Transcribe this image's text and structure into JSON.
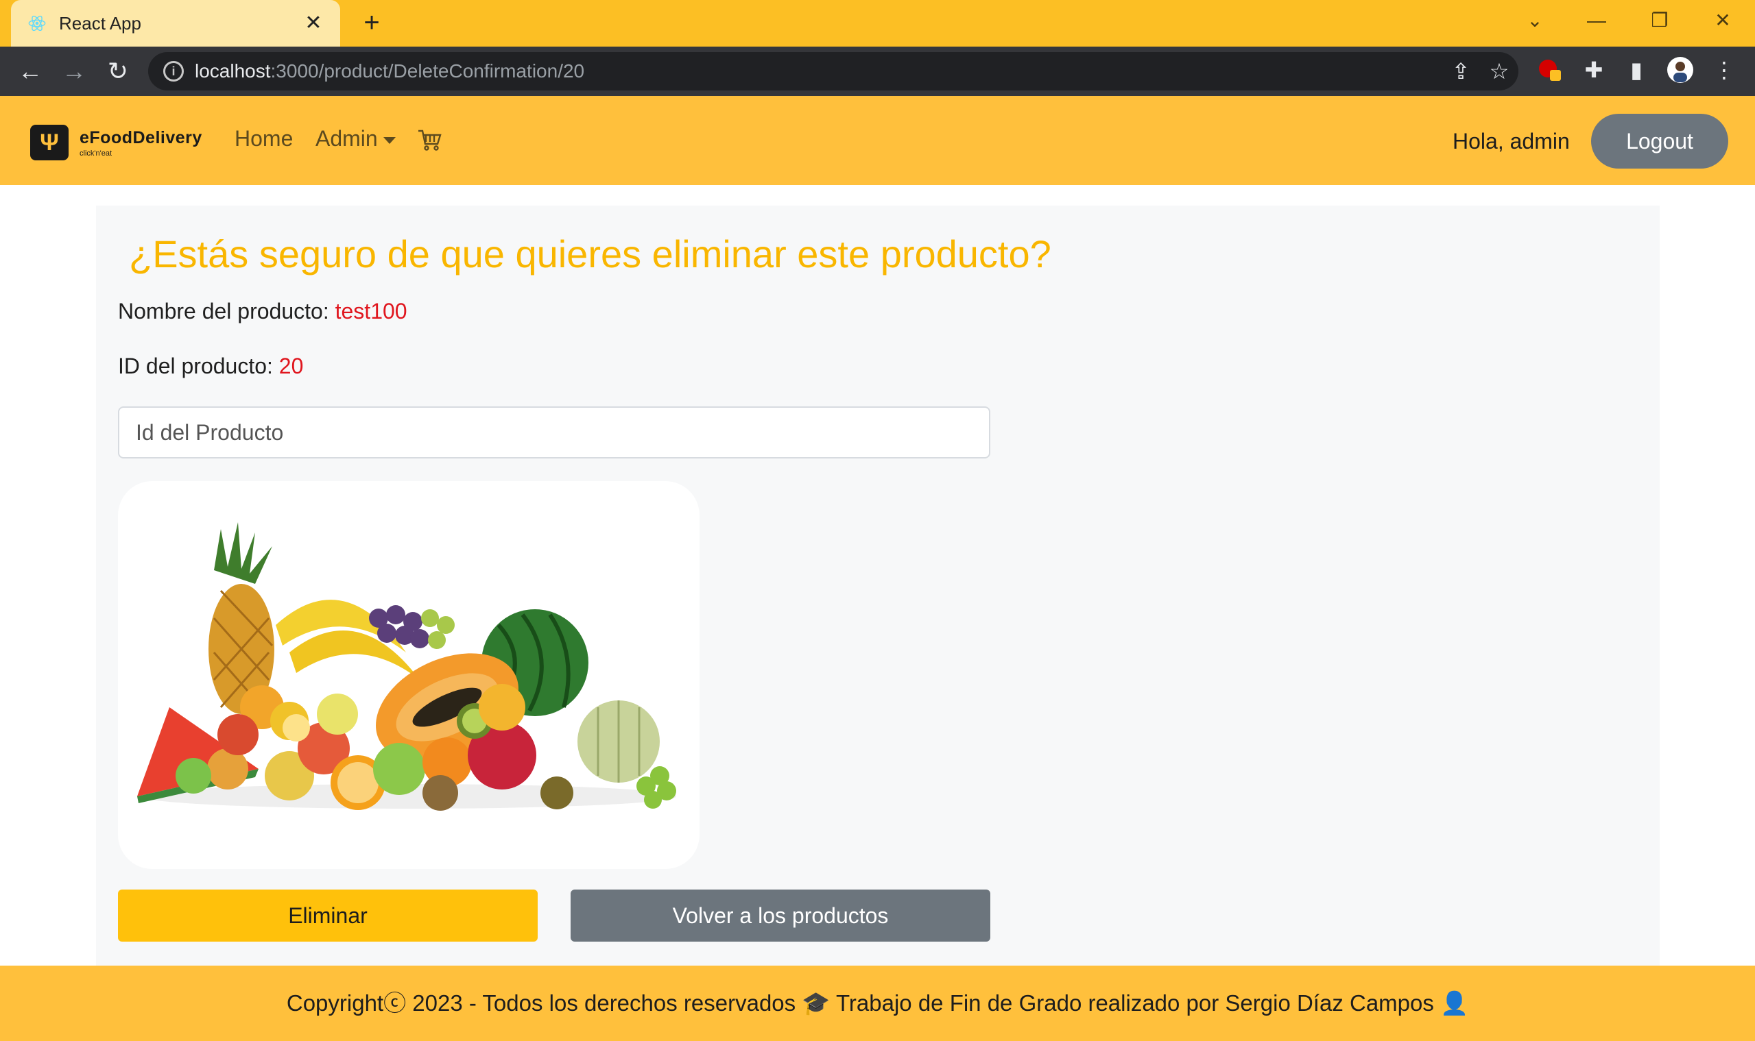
{
  "browser": {
    "tab_title": "React App",
    "url_host": "localhost",
    "url_path": ":3000/product/DeleteConfirmation/20"
  },
  "navbar": {
    "brand_name": "eFoodDelivery",
    "brand_tagline": "click'n'eat",
    "home_label": "Home",
    "admin_label": "Admin",
    "greeting": "Hola, admin",
    "logout_label": "Logout"
  },
  "page": {
    "heading": "¿Estás seguro de que quieres eliminar este producto?",
    "name_label": "Nombre del producto: ",
    "name_value": "test100",
    "id_label": "ID del producto: ",
    "id_value": "20",
    "input_placeholder": "Id del Producto",
    "delete_label": "Eliminar",
    "back_label": "Volver a los productos"
  },
  "footer": {
    "text": "Copyrightⓒ 2023 - Todos los derechos reservados 🎓 Trabajo de Fin de Grado realizado por Sergio Díaz Campos 👤"
  },
  "colors": {
    "accent": "#ffc03c",
    "heading": "#f9b600",
    "value": "#e0161e",
    "secondary": "#6c757d"
  }
}
